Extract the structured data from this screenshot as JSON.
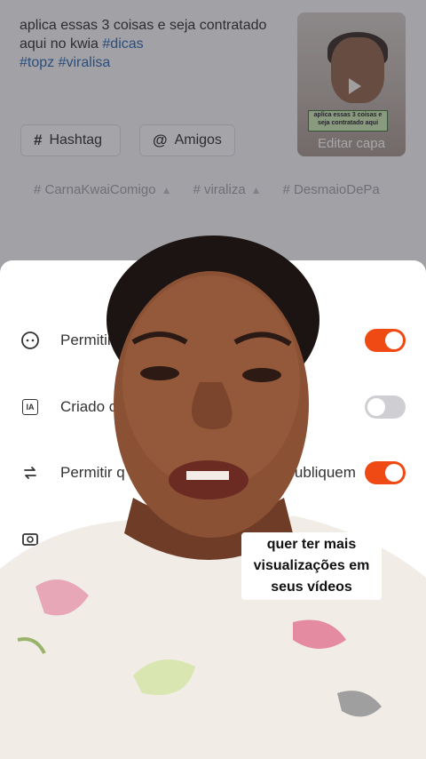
{
  "caption": {
    "text": "aplica essas 3 coisas  e seja contratado aqui no kwia ",
    "tags": [
      "#dicas",
      "#topz",
      "#viralisa"
    ]
  },
  "cover": {
    "edit_label": "Editar capa",
    "card_text": "aplica essas 3 coisas e seja contratado aqui"
  },
  "chips": [
    {
      "icon": "#",
      "label": "Hashtag"
    },
    {
      "icon": "@",
      "label": "Amigos"
    }
  ],
  "suggestions": [
    "# CarnaKwaiComigo",
    "# viraliza",
    "# DesmaioDePa"
  ],
  "settings": [
    {
      "icon": "comment-icon",
      "label": "Permitir",
      "enabled": true
    },
    {
      "icon": "ai-generated-icon",
      "icon_text": "IA",
      "label": "Criado c",
      "enabled": false
    },
    {
      "icon": "repost-icon",
      "label": "Permitir q",
      "label_right": "epubliquem",
      "enabled": true
    }
  ],
  "subtitle": "quer ter mais visualizações em seus vídeos",
  "colors": {
    "toggle_on": "#f04a14",
    "toggle_off": "#cfcfd3",
    "hashtag_link": "#1f5ea8"
  }
}
